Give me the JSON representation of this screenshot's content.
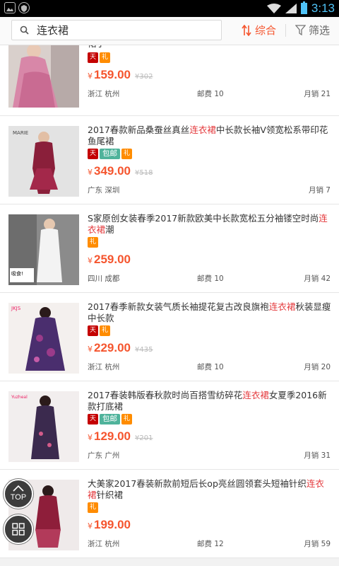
{
  "status_bar": {
    "time": "3:13"
  },
  "search": {
    "query": "连衣裙",
    "placeholder": ""
  },
  "sort": {
    "label": "综合"
  },
  "filter": {
    "label": "筛选"
  },
  "fab": {
    "top_label": "TOP"
  },
  "colors": {
    "accent": "#f5552e",
    "highlight": "#e4393c",
    "tag_mall": "#c40000",
    "tag_gift": "#ff8c00",
    "tag_free": "#4fb39b",
    "status_accent": "#4fc3f7"
  },
  "products": [
    {
      "title_pre": "",
      "title_hl": "",
      "title_post": "裙子",
      "tags": [
        "mall",
        "gift"
      ],
      "price": "159.00",
      "old_price": "302",
      "location": "浙江 杭州",
      "shipping": "邮费 10",
      "sales": "月销 21"
    },
    {
      "title_pre": "2017春款新品桑蚕丝真丝",
      "title_hl": "连衣裙",
      "title_post": "中长款长袖V领宽松系带印花鱼尾裙",
      "tags": [
        "mall",
        "free",
        "gift"
      ],
      "free_label": "包邮",
      "price": "349.00",
      "old_price": "518",
      "location": "广东 深圳",
      "shipping": "",
      "sales": "月销 7"
    },
    {
      "title_pre": "S家原创女装春季2017新款欧美中长款宽松五分袖镂空时尚",
      "title_hl": "连衣裙",
      "title_post": "潮",
      "tags": [
        "gift"
      ],
      "price": "259.00",
      "old_price": "",
      "location": "四川 成都",
      "shipping": "邮费 10",
      "sales": "月销 42"
    },
    {
      "title_pre": "2017春季新款女装气质长袖提花复古改良旗袍",
      "title_hl": "连衣裙",
      "title_post": "秋装显瘦中长款",
      "tags": [
        "mall",
        "gift"
      ],
      "price": "229.00",
      "old_price": "435",
      "location": "浙江 杭州",
      "shipping": "邮费 10",
      "sales": "月销 20"
    },
    {
      "title_pre": "2017春装韩版春秋款时尚百搭雪纺碎花",
      "title_hl": "连衣裙",
      "title_post": "女夏季2016新款打底裙",
      "tags": [
        "mall",
        "free",
        "gift"
      ],
      "free_label": "包邮",
      "price": "129.00",
      "old_price": "201",
      "location": "广东 广州",
      "shipping": "",
      "sales": "月销 31"
    },
    {
      "title_pre": "大美家2017春装新款前短后长op亮丝圆领套头短袖针织",
      "title_hl": "连衣裙",
      "title_post": "针织裙",
      "tags": [
        "gift"
      ],
      "price": "199.00",
      "old_price": "",
      "location": "浙江 杭州",
      "shipping": "邮费 12",
      "sales": "月销 59"
    }
  ]
}
